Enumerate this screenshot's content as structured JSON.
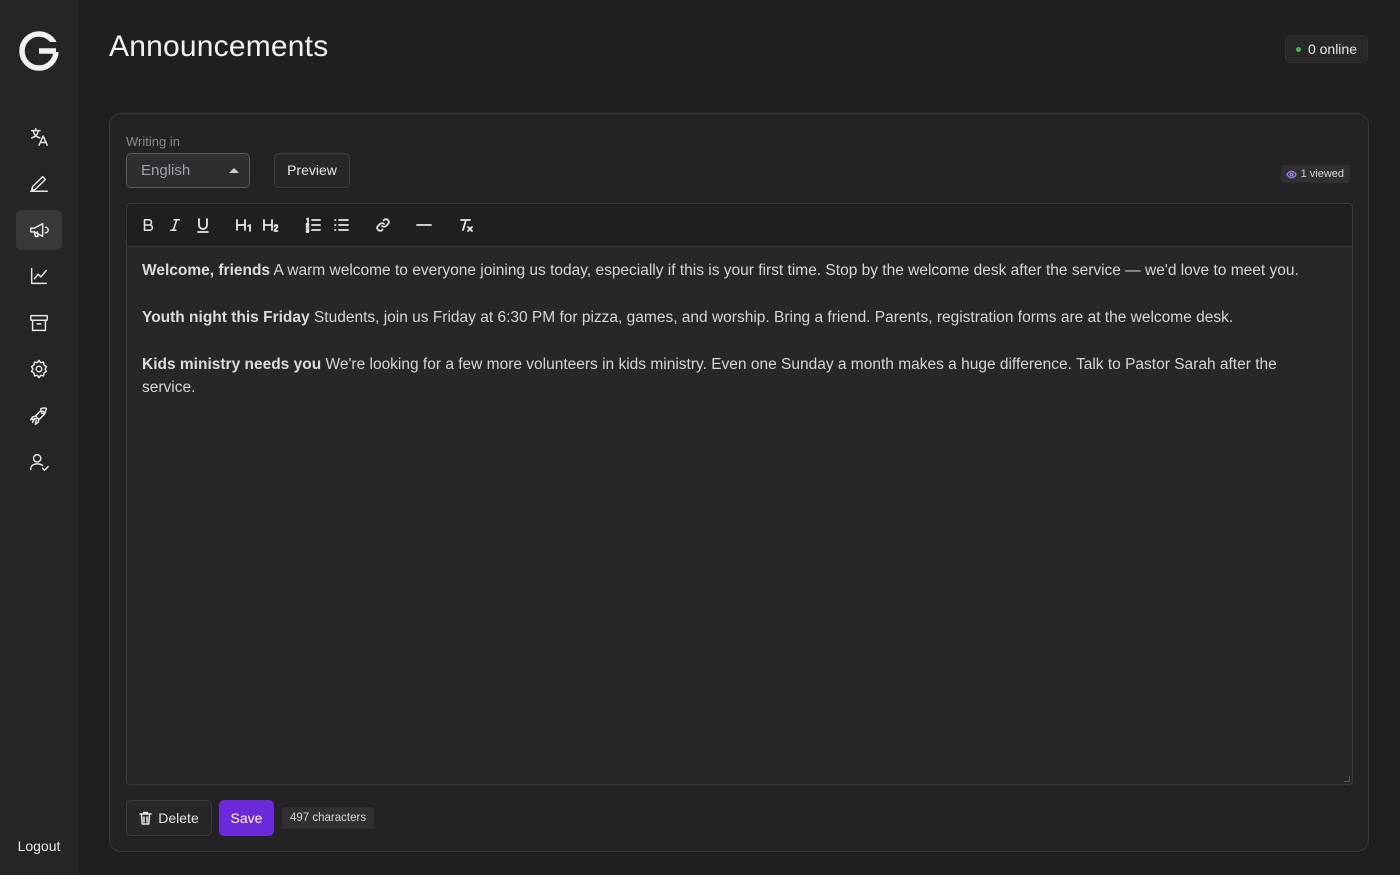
{
  "header": {
    "title": "Announcements",
    "online_status": "0 online"
  },
  "sidebar": {
    "items": [
      {
        "name": "translate",
        "icon": "translate-icon"
      },
      {
        "name": "write",
        "icon": "pencil-icon"
      },
      {
        "name": "announcements",
        "icon": "megaphone-icon",
        "active": true
      },
      {
        "name": "analytics",
        "icon": "line-chart-icon"
      },
      {
        "name": "archive",
        "icon": "archive-icon"
      },
      {
        "name": "settings",
        "icon": "gear-icon"
      },
      {
        "name": "launch",
        "icon": "rocket-icon"
      },
      {
        "name": "users",
        "icon": "user-check-icon"
      }
    ],
    "logout_label": "Logout"
  },
  "editor": {
    "writing_label": "Writing in",
    "language": "English",
    "preview_label": "Preview",
    "viewed": "1 viewed",
    "toolbar": [
      "bold",
      "italic",
      "underline",
      "heading-1",
      "heading-2",
      "ordered-list",
      "bullet-list",
      "link",
      "horizontal-rule",
      "clear-format"
    ],
    "paragraphs": [
      {
        "title": "Welcome, friends",
        "body": "A warm welcome to everyone joining us today, especially if this is your first time. Stop by the welcome desk after the service — we'd love to meet you."
      },
      {
        "title": "Youth night this Friday",
        "body": "Students, join us Friday at 6:30 PM for pizza, games, and worship. Bring a friend. Parents, registration forms are at the welcome desk."
      },
      {
        "title": "Kids ministry needs you",
        "body": "We're looking for a few more volunteers in kids ministry. Even one Sunday a month makes a huge difference. Talk to Pastor Sarah after the service."
      }
    ]
  },
  "actions": {
    "delete_label": "Delete",
    "save_label": "Save",
    "char_count": "497 characters"
  },
  "colors": {
    "accent": "#6d28d9",
    "online_dot": "#3fb950",
    "background": "#1f1f21"
  }
}
